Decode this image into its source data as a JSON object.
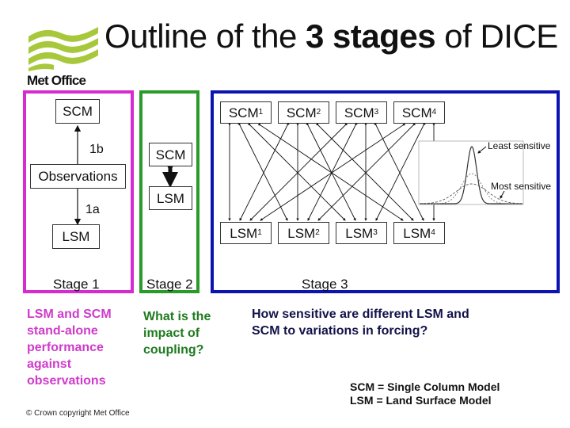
{
  "title": {
    "prefix": "Outline of the ",
    "bold": "3 stages",
    "suffix": " of DICE"
  },
  "logo": {
    "icon": "met-office-waves-icon",
    "text": "Met Office",
    "color": "#a8c83c"
  },
  "colors": {
    "stage1": "#d62bd0",
    "stage2": "#2a9a2a",
    "stage3": "#0b14b0"
  },
  "stage1": {
    "label": "Stage 1",
    "boxes": {
      "scm": "SCM",
      "observations": "Observations",
      "lsm": "LSM"
    },
    "arrow_labels": {
      "up": "1b",
      "down": "1a"
    },
    "description": "LSM and SCM stand-alone performance against observations"
  },
  "stage2": {
    "label": "Stage 2",
    "boxes": {
      "scm": "SCM",
      "lsm": "LSM"
    },
    "description": "What is the impact of coupling?"
  },
  "stage3": {
    "label": "Stage 3",
    "scm_boxes": [
      {
        "name": "SCM",
        "sub": "1"
      },
      {
        "name": "SCM",
        "sub": "2"
      },
      {
        "name": "SCM",
        "sub": "3"
      },
      {
        "name": "SCM",
        "sub": "4"
      }
    ],
    "lsm_boxes": [
      {
        "name": "LSM",
        "sub": "1"
      },
      {
        "name": "LSM",
        "sub": "2"
      },
      {
        "name": "LSM",
        "sub": "3"
      },
      {
        "name": "LSM",
        "sub": "4"
      }
    ],
    "sensitivity_plot": {
      "least_label": "Least sensitive",
      "most_label": "Most sensitive"
    },
    "description": "How sensitive are different LSM and SCM to variations in forcing?"
  },
  "legend": {
    "scm": "SCM = Single Column Model",
    "lsm": "LSM = Land Surface Model"
  },
  "footer": {
    "copyright": "© Crown copyright   Met Office"
  }
}
